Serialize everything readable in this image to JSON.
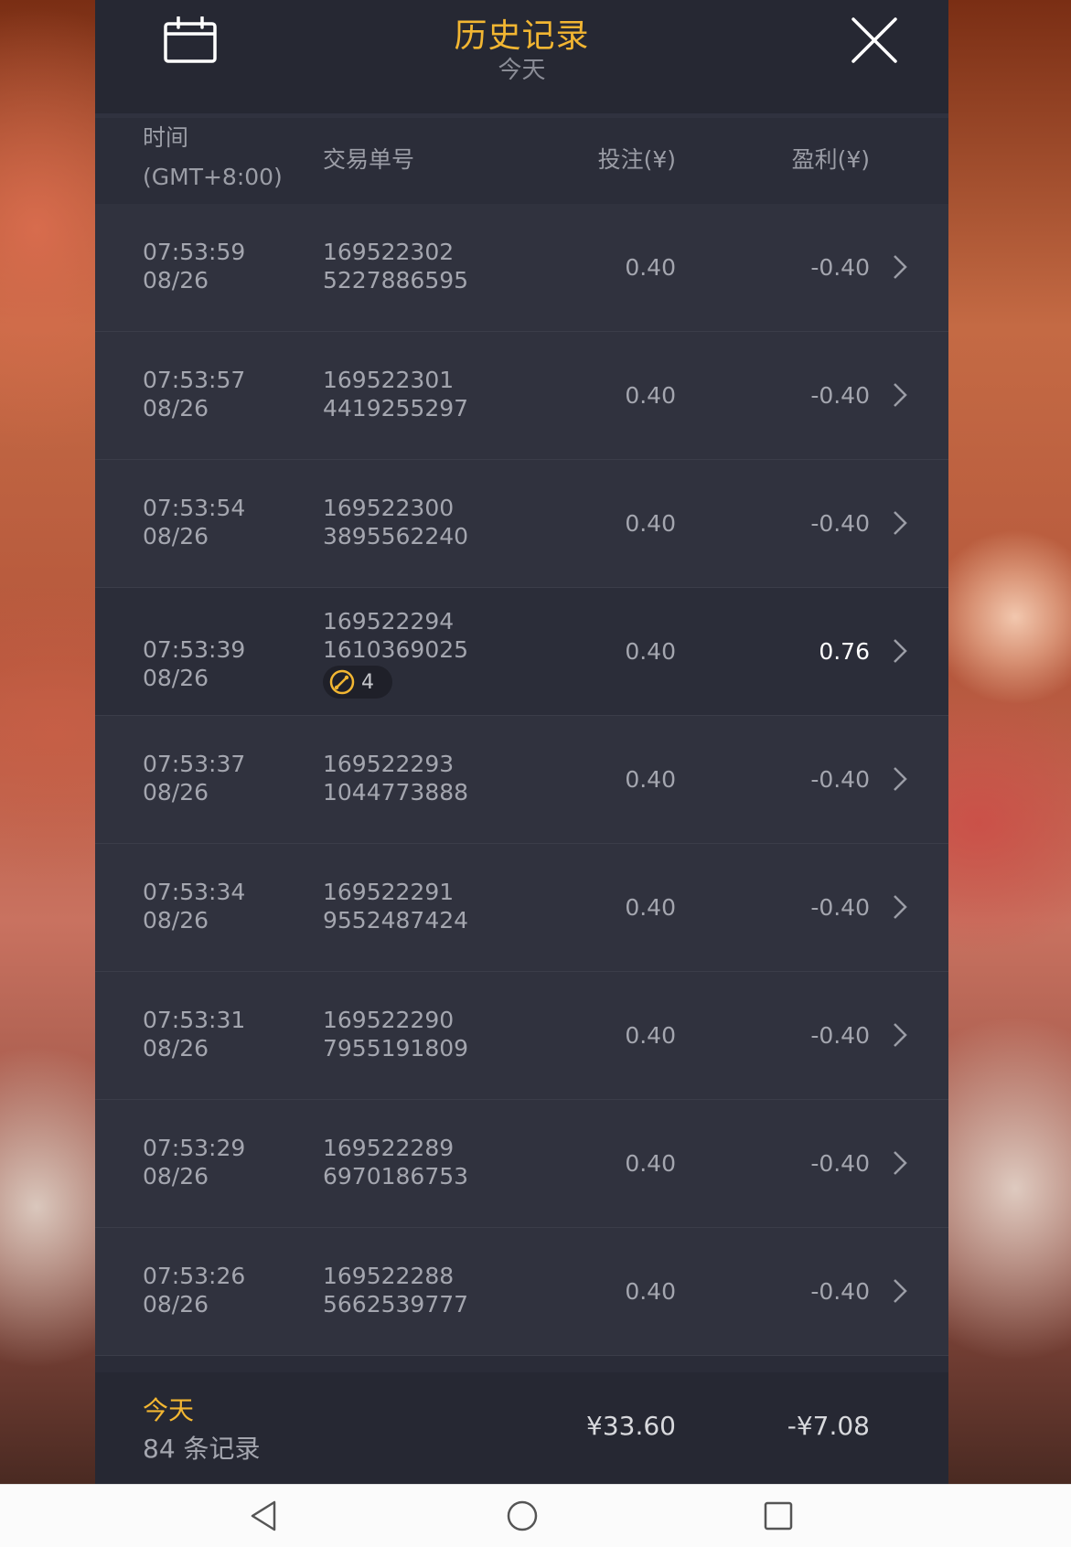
{
  "header": {
    "title": "历史记录",
    "subtitle": "今天",
    "calendar_icon": "calendar-icon",
    "close_icon": "close-icon"
  },
  "columns": {
    "time_line1": "时间",
    "time_line2": "(GMT+8:00)",
    "order": "交易单号",
    "bet": "投注(¥)",
    "profit": "盈利(¥)"
  },
  "rows": [
    {
      "time": "07:53:59",
      "date": "08/26",
      "order_1": "169522302",
      "order_2": "5227886595",
      "bet": "0.40",
      "profit": "-0.40"
    },
    {
      "time": "07:53:57",
      "date": "08/26",
      "order_1": "169522301",
      "order_2": "4419255297",
      "bet": "0.40",
      "profit": "-0.40"
    },
    {
      "time": "07:53:54",
      "date": "08/26",
      "order_1": "169522300",
      "order_2": "3895562240",
      "bet": "0.40",
      "profit": "-0.40"
    },
    {
      "time": "07:53:39",
      "date": "08/26",
      "order_1": "169522294",
      "order_2": "1610369025",
      "bet": "0.40",
      "profit": "0.76",
      "badge_count": "4"
    },
    {
      "time": "07:53:37",
      "date": "08/26",
      "order_1": "169522293",
      "order_2": "1044773888",
      "bet": "0.40",
      "profit": "-0.40"
    },
    {
      "time": "07:53:34",
      "date": "08/26",
      "order_1": "169522291",
      "order_2": "9552487424",
      "bet": "0.40",
      "profit": "-0.40"
    },
    {
      "time": "07:53:31",
      "date": "08/26",
      "order_1": "169522290",
      "order_2": "7955191809",
      "bet": "0.40",
      "profit": "-0.40"
    },
    {
      "time": "07:53:29",
      "date": "08/26",
      "order_1": "169522289",
      "order_2": "6970186753",
      "bet": "0.40",
      "profit": "-0.40"
    },
    {
      "time": "07:53:26",
      "date": "08/26",
      "order_1": "169522288",
      "order_2": "5662539777",
      "bet": "0.40",
      "profit": "-0.40"
    }
  ],
  "footer": {
    "period": "今天",
    "record_count": "84 条记录",
    "total_bet": "¥33.60",
    "total_profit": "-¥7.08"
  },
  "colors": {
    "accent": "#f2b632",
    "panel": "#2a2c38",
    "text": "#a4a6af"
  },
  "navbar": {
    "icons": [
      "back-icon",
      "home-icon",
      "recents-icon"
    ]
  }
}
